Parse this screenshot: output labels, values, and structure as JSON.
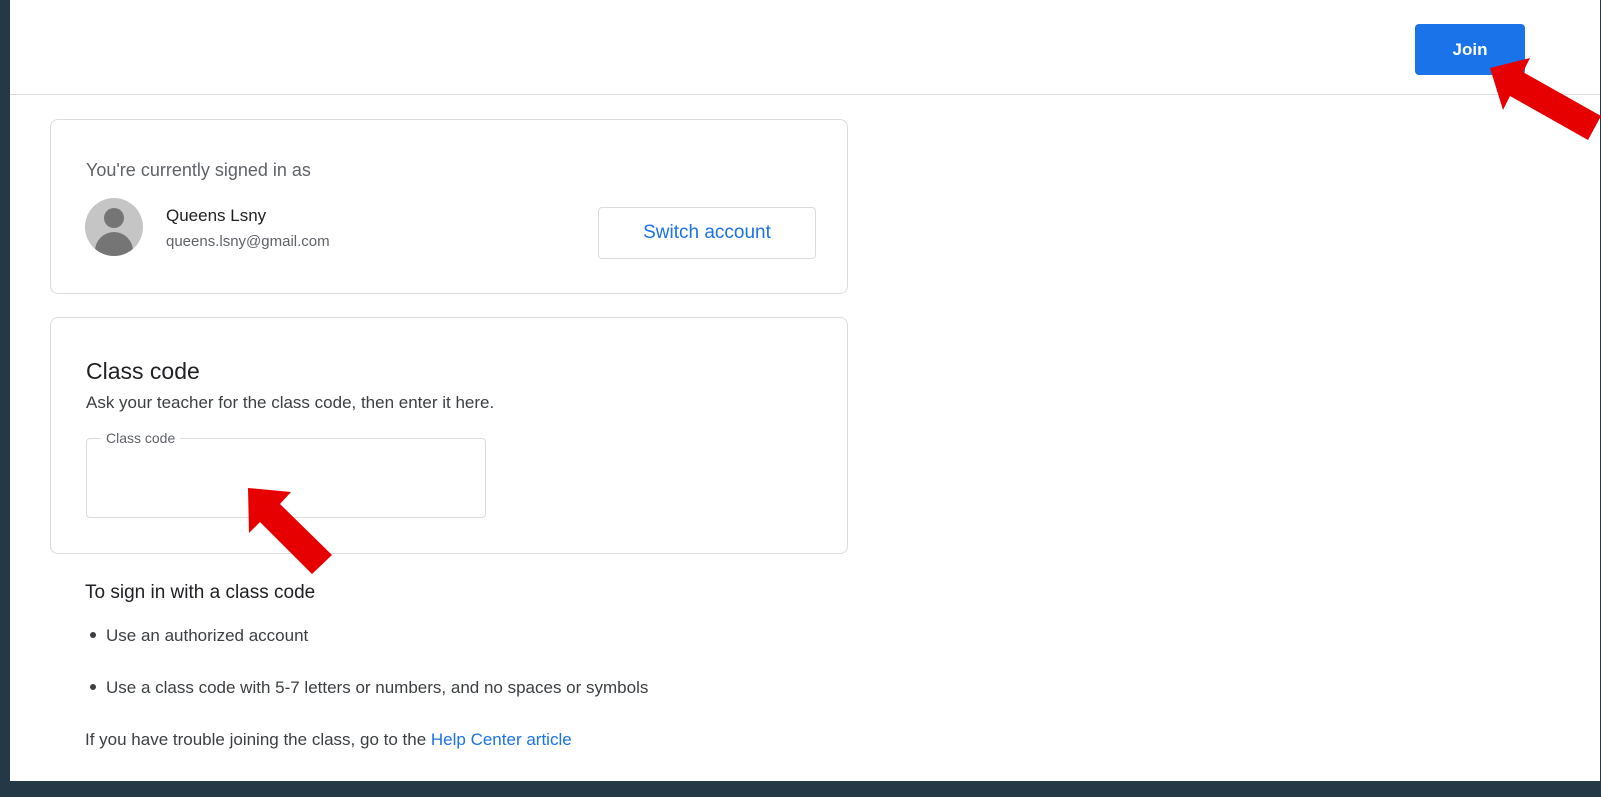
{
  "header": {
    "join_label": "Join"
  },
  "account": {
    "signed_in_label": "You're currently signed in as",
    "name": "Queens Lsny",
    "email": "queens.lsny@gmail.com",
    "switch_label": "Switch account"
  },
  "class_code": {
    "title": "Class code",
    "description": "Ask your teacher for the class code, then enter it here.",
    "field_label": "Class code",
    "value": ""
  },
  "instructions": {
    "title": "To sign in with a class code",
    "items": [
      "Use an authorized account",
      "Use a class code with 5-7 letters or numbers, and no spaces or symbols"
    ],
    "help_prefix": "If you have trouble joining the class, go to the ",
    "help_link": "Help Center article"
  },
  "colors": {
    "accent": "#1a73e8",
    "annotation_arrow": "#e60000",
    "frame_background": "#253845"
  }
}
